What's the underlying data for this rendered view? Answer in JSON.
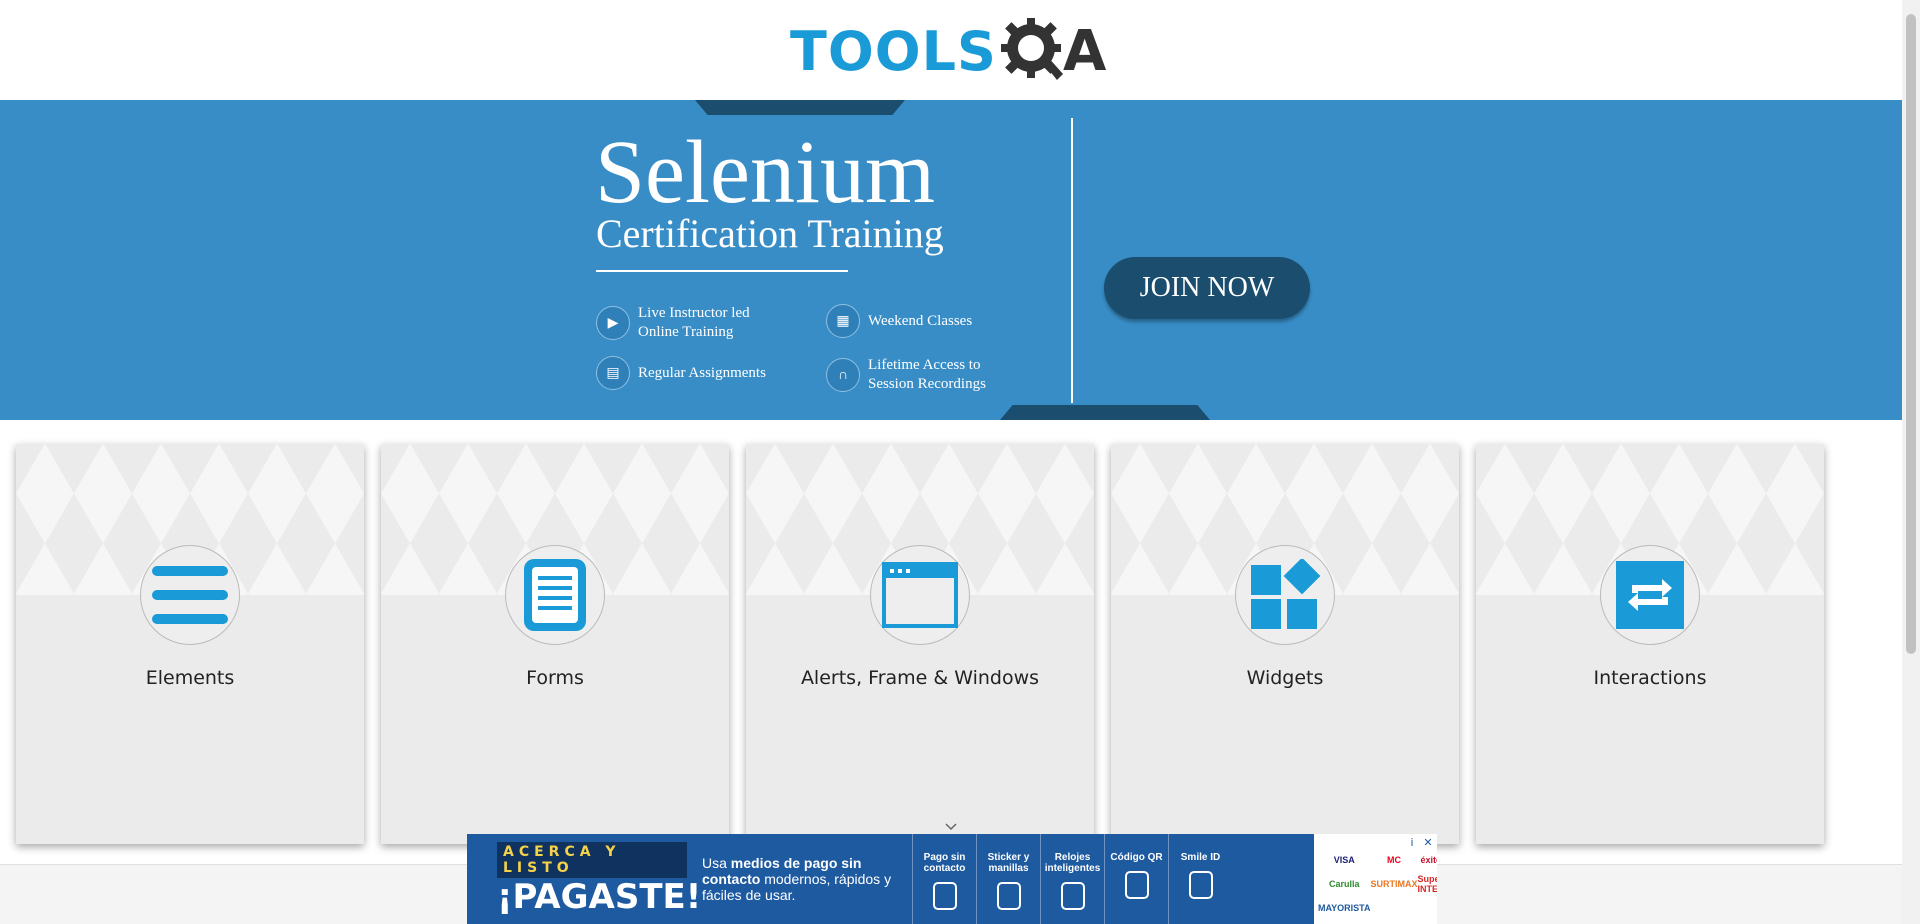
{
  "logo": {
    "text_left": "TOOLS",
    "text_right": "A",
    "icon": "gear-magnifier-icon",
    "color": "#1a9bd7"
  },
  "banner": {
    "title": "Selenium",
    "subtitle": "Certification Training",
    "features": [
      {
        "icon": "play-icon",
        "label": "Live Instructor led Online Training"
      },
      {
        "icon": "calendar-icon",
        "label": "Weekend Classes"
      },
      {
        "icon": "document-icon",
        "label": "Regular Assignments"
      },
      {
        "icon": "headphones-icon",
        "label": "Lifetime Access to Session Recordings"
      }
    ],
    "cta": "JOIN NOW",
    "background": "#388dc7",
    "accent": "#1b4e6e"
  },
  "cards": [
    {
      "title": "Elements",
      "icon": "hamburger-list-icon"
    },
    {
      "title": "Forms",
      "icon": "document-form-icon"
    },
    {
      "title": "Alerts, Frame & Windows",
      "icon": "browser-window-icon"
    },
    {
      "title": "Widgets",
      "icon": "widgets-grid-icon"
    },
    {
      "title": "Interactions",
      "icon": "swap-arrows-icon"
    }
  ],
  "ad": {
    "tagline_top": "ACERCA Y LISTO",
    "tagline_main": "¡PAGASTE!",
    "copy_prefix": "Usa ",
    "copy_bold": "medios de pago sin contacto",
    "copy_suffix": " modernos, rápidos y fáciles de usar.",
    "items": [
      "Pago sin contacto",
      "Sticker y manillas",
      "Relojes inteligentes",
      "Código QR",
      "Smile ID"
    ],
    "logos": [
      "VISA",
      "MC",
      "éxito",
      "Carulla",
      "SURTIMAX",
      "Super INTER",
      "MAYORISTA"
    ],
    "info": "i",
    "close": "✕"
  }
}
